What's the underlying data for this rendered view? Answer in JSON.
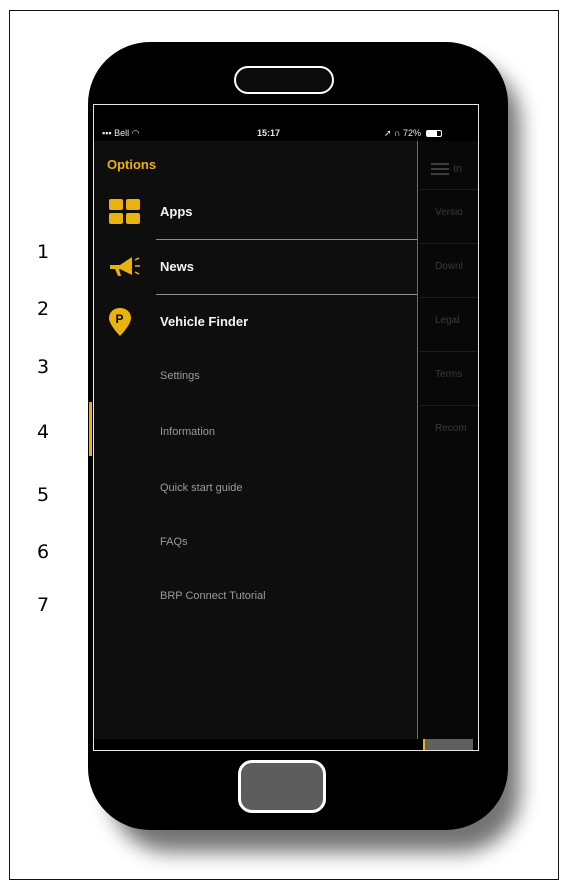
{
  "callouts": [
    "1",
    "2",
    "3",
    "4",
    "5",
    "6",
    "7"
  ],
  "status_bar": {
    "carrier": "Bell",
    "time": "15:17",
    "battery": "72%"
  },
  "drawer": {
    "title": "Options",
    "items": [
      {
        "label": "Apps",
        "icon": "apps-grid-icon"
      },
      {
        "label": "News",
        "icon": "megaphone-icon"
      },
      {
        "label": "Vehicle Finder",
        "icon": "location-pin-p-icon"
      },
      {
        "label": "Settings"
      },
      {
        "label": "Information"
      },
      {
        "label": "Quick start guide"
      },
      {
        "label": "FAQs"
      },
      {
        "label": "BRP Connect Tutorial"
      }
    ]
  },
  "background_page": {
    "title": "In",
    "rows": [
      "Versio",
      "Downl",
      "Legal",
      "Terms",
      "Recom"
    ]
  },
  "colors": {
    "accent": "#e9b20d",
    "drawer_bg": "#0e0e0e",
    "phone_body": "#000000"
  }
}
